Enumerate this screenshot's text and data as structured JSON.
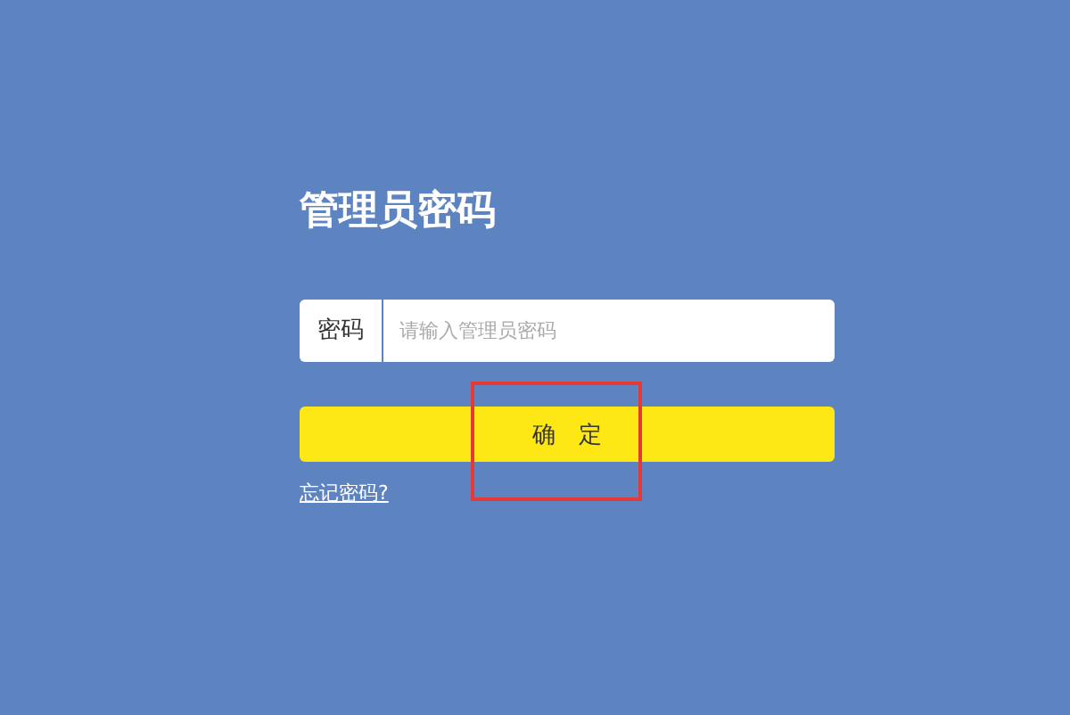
{
  "title": "管理员密码",
  "password_field": {
    "label": "密码",
    "placeholder": "请输入管理员密码"
  },
  "confirm_button": {
    "label": "确　定"
  },
  "forgot_link": "忘记密码?"
}
